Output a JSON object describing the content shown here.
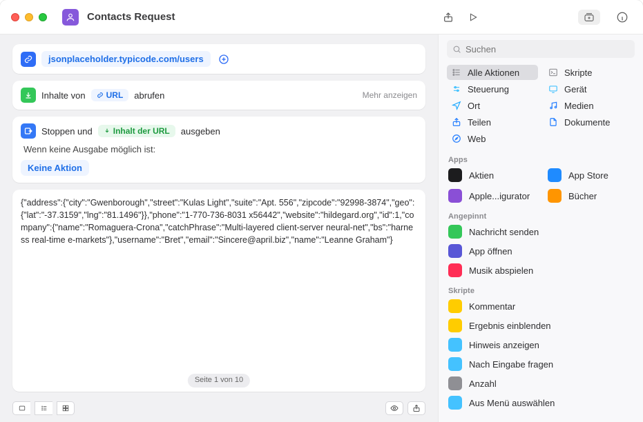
{
  "title": "Contacts Request",
  "url_block": {
    "url": "jsonplaceholder.typicode.com/users"
  },
  "get_block": {
    "pre": "Inhalte von",
    "token": "URL",
    "post": "abrufen",
    "more": "Mehr anzeigen"
  },
  "stop_block": {
    "pre": "Stoppen und",
    "token": "Inhalt der URL",
    "post": "ausgeben",
    "sub": "Wenn keine Ausgabe möglich ist:",
    "none": "Keine Aktion"
  },
  "result_json": "{\"address\":{\"city\":\"Gwenborough\",\"street\":\"Kulas Light\",\"suite\":\"Apt. 556\",\"zipcode\":\"92998-3874\",\"geo\":{\"lat\":\"-37.3159\",\"lng\":\"81.1496\"}},\"phone\":\"1-770-736-8031 x56442\",\"website\":\"hildegard.org\",\"id\":1,\"company\":{\"name\":\"Romaguera-Crona\",\"catchPhrase\":\"Multi-layered client-server neural-net\",\"bs\":\"harness real-time e-markets\"},\"username\":\"Bret\",\"email\":\"Sincere@april.biz\",\"name\":\"Leanne Graham\"}",
  "page_indicator": "Seite 1 von 10",
  "search_placeholder": "Suchen",
  "categories": [
    {
      "label": "Alle Aktionen",
      "icon": "list",
      "color": "#8f8f94",
      "active": true
    },
    {
      "label": "Skripte",
      "icon": "terminal",
      "color": "#8f8f94"
    },
    {
      "label": "Steuerung",
      "icon": "sliders",
      "color": "#44c2ff"
    },
    {
      "label": "Gerät",
      "icon": "device",
      "color": "#44c2ff"
    },
    {
      "label": "Ort",
      "icon": "location",
      "color": "#1fa9ff"
    },
    {
      "label": "Medien",
      "icon": "music",
      "color": "#1f7bff"
    },
    {
      "label": "Teilen",
      "icon": "share",
      "color": "#1f7bff"
    },
    {
      "label": "Dokumente",
      "icon": "doc",
      "color": "#1f7bff"
    },
    {
      "label": "Web",
      "icon": "safari",
      "color": "#1f7bff"
    }
  ],
  "section_apps": {
    "title": "Apps",
    "items": [
      {
        "label": "Aktien",
        "color": "#1c1c1e"
      },
      {
        "label": "App Store",
        "color": "#1f8bff"
      },
      {
        "label": "Apple...igurator",
        "color": "#8a4fd6",
        "truncated": true
      },
      {
        "label": "Bücher",
        "color": "#ff9500",
        "truncated": true
      }
    ]
  },
  "section_pinned": {
    "title": "Angepinnt",
    "items": [
      {
        "label": "Nachricht senden",
        "color": "#34c759"
      },
      {
        "label": "App öffnen",
        "color": "#5856d6"
      },
      {
        "label": "Musik abspielen",
        "color": "#ff2d55"
      }
    ]
  },
  "section_scripts": {
    "title": "Skripte",
    "items": [
      {
        "label": "Kommentar",
        "color": "#ffcc00"
      },
      {
        "label": "Ergebnis einblenden",
        "color": "#ffcc00"
      },
      {
        "label": "Hinweis anzeigen",
        "color": "#44c2ff"
      },
      {
        "label": "Nach Eingabe fragen",
        "color": "#44c2ff"
      },
      {
        "label": "Anzahl",
        "color": "#8f8f94"
      },
      {
        "label": "Aus Menü auswählen",
        "color": "#44c2ff"
      }
    ]
  }
}
